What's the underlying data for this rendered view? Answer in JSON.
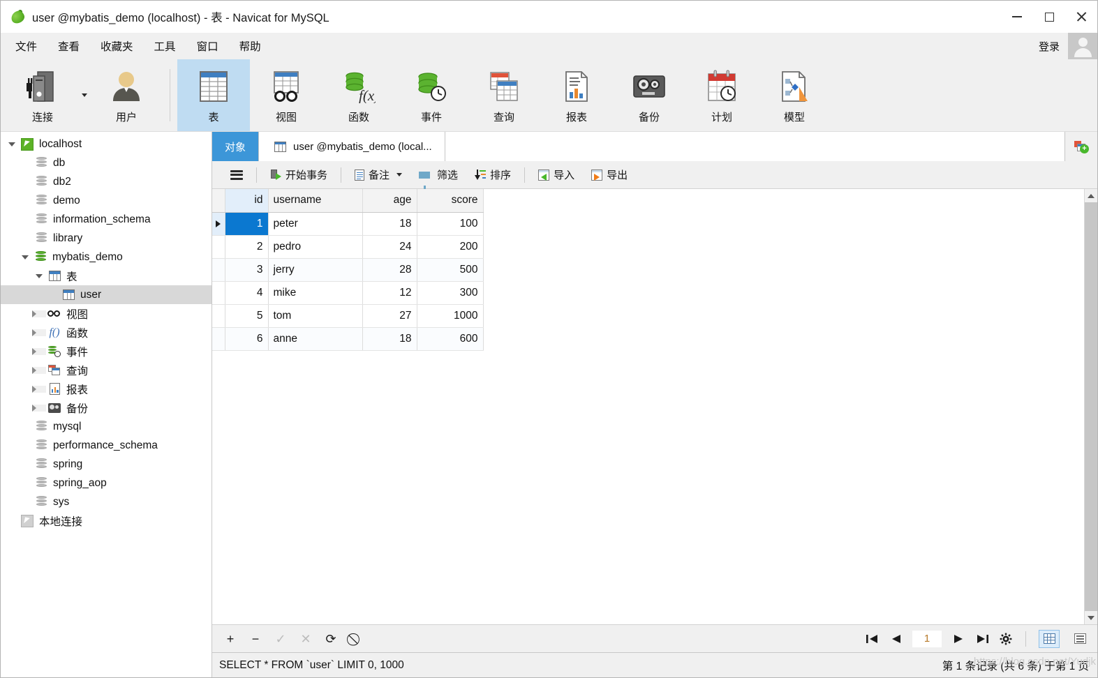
{
  "window": {
    "title": "user @mybatis_demo (localhost) - 表 - Navicat for MySQL",
    "logo": "navicat-leaf-icon",
    "minimize": "minimize-icon",
    "maximize": "maximize-icon",
    "close": "close-icon"
  },
  "menubar": {
    "items": [
      {
        "label": "文件"
      },
      {
        "label": "查看"
      },
      {
        "label": "收藏夹"
      },
      {
        "label": "工具"
      },
      {
        "label": "窗口"
      },
      {
        "label": "帮助"
      }
    ],
    "login_label": "登录"
  },
  "toolbar": {
    "items": [
      {
        "label": "连接",
        "icon": "connection-icon",
        "active": false,
        "has_dropdown": true
      },
      {
        "label": "用户",
        "icon": "user-icon",
        "active": false
      },
      {
        "label": "表",
        "icon": "table-icon",
        "active": true
      },
      {
        "label": "视图",
        "icon": "view-icon",
        "active": false
      },
      {
        "label": "函数",
        "icon": "function-icon",
        "active": false
      },
      {
        "label": "事件",
        "icon": "event-icon",
        "active": false
      },
      {
        "label": "查询",
        "icon": "query-icon",
        "active": false
      },
      {
        "label": "报表",
        "icon": "report-icon",
        "active": false
      },
      {
        "label": "备份",
        "icon": "backup-icon",
        "active": false
      },
      {
        "label": "计划",
        "icon": "schedule-icon",
        "active": false
      },
      {
        "label": "模型",
        "icon": "model-icon",
        "active": false
      }
    ]
  },
  "sidebar": {
    "nodes": [
      {
        "label": "localhost",
        "icon": "connection-green-icon",
        "indent": 0,
        "expander": "down",
        "selected": false
      },
      {
        "label": "db",
        "icon": "database-gray-icon",
        "indent": 1,
        "expander": "none",
        "selected": false
      },
      {
        "label": "db2",
        "icon": "database-gray-icon",
        "indent": 1,
        "expander": "none",
        "selected": false
      },
      {
        "label": "demo",
        "icon": "database-gray-icon",
        "indent": 1,
        "expander": "none",
        "selected": false
      },
      {
        "label": "information_schema",
        "icon": "database-gray-icon",
        "indent": 1,
        "expander": "none",
        "selected": false
      },
      {
        "label": "library",
        "icon": "database-gray-icon",
        "indent": 1,
        "expander": "none",
        "selected": false
      },
      {
        "label": "mybatis_demo",
        "icon": "database-green-icon",
        "indent": 1,
        "expander": "down",
        "selected": false
      },
      {
        "label": "表",
        "icon": "table-icon",
        "indent": 2,
        "expander": "down",
        "selected": false
      },
      {
        "label": "user",
        "icon": "table-icon",
        "indent": 3,
        "expander": "none",
        "selected": true
      },
      {
        "label": "视图",
        "icon": "view-icon",
        "indent": 2,
        "expander": "right",
        "selected": false
      },
      {
        "label": "函数",
        "icon": "function-icon",
        "indent": 2,
        "expander": "right",
        "selected": false
      },
      {
        "label": "事件",
        "icon": "event-icon",
        "indent": 2,
        "expander": "right",
        "selected": false
      },
      {
        "label": "查询",
        "icon": "query-icon",
        "indent": 2,
        "expander": "right",
        "selected": false
      },
      {
        "label": "报表",
        "icon": "report-icon",
        "indent": 2,
        "expander": "right",
        "selected": false
      },
      {
        "label": "备份",
        "icon": "backup-icon",
        "indent": 2,
        "expander": "right",
        "selected": false
      },
      {
        "label": "mysql",
        "icon": "database-gray-icon",
        "indent": 1,
        "expander": "none",
        "selected": false
      },
      {
        "label": "performance_schema",
        "icon": "database-gray-icon",
        "indent": 1,
        "expander": "none",
        "selected": false
      },
      {
        "label": "spring",
        "icon": "database-gray-icon",
        "indent": 1,
        "expander": "none",
        "selected": false
      },
      {
        "label": "spring_aop",
        "icon": "database-gray-icon",
        "indent": 1,
        "expander": "none",
        "selected": false
      },
      {
        "label": "sys",
        "icon": "database-gray-icon",
        "indent": 1,
        "expander": "none",
        "selected": false
      },
      {
        "label": "本地连接",
        "icon": "connection-gray-icon",
        "indent": 0,
        "expander": "none",
        "selected": false
      }
    ]
  },
  "tabs": {
    "items": [
      {
        "label": "对象",
        "active": true,
        "icon": "none"
      },
      {
        "label": "user @mybatis_demo (local...",
        "active": false,
        "icon": "table-icon"
      }
    ],
    "add_button": "new-query-icon"
  },
  "actionbar": {
    "menu_icon": "hamburger-icon",
    "items": [
      {
        "label": "开始事务",
        "icon": "transaction-icon",
        "dropdown": false
      },
      {
        "label": "备注",
        "icon": "note-icon",
        "dropdown": true
      },
      {
        "label": "筛选",
        "icon": "filter-icon",
        "dropdown": false
      },
      {
        "label": "排序",
        "icon": "sort-icon",
        "dropdown": false
      },
      {
        "label": "导入",
        "icon": "import-icon",
        "dropdown": false
      },
      {
        "label": "导出",
        "icon": "export-icon",
        "dropdown": false
      }
    ]
  },
  "grid": {
    "columns": [
      "id",
      "username",
      "age",
      "score"
    ],
    "active_column": "id",
    "rows": [
      {
        "id": "1",
        "username": "peter",
        "age": "18",
        "score": "100"
      },
      {
        "id": "2",
        "username": "pedro",
        "age": "24",
        "score": "200"
      },
      {
        "id": "3",
        "username": "jerry",
        "age": "28",
        "score": "500"
      },
      {
        "id": "4",
        "username": "mike",
        "age": "12",
        "score": "300"
      },
      {
        "id": "5",
        "username": "tom",
        "age": "27",
        "score": "1000"
      },
      {
        "id": "6",
        "username": "anne",
        "age": "18",
        "score": "600"
      }
    ],
    "selected_row": 0,
    "selected_cell_column": "id"
  },
  "navbar": {
    "record_actions": [
      {
        "icon": "plus-icon",
        "label": "+",
        "enabled": true
      },
      {
        "icon": "minus-icon",
        "label": "−",
        "enabled": true
      },
      {
        "icon": "check-icon",
        "label": "✓",
        "enabled": false
      },
      {
        "icon": "cancel-x-icon",
        "label": "✕",
        "enabled": false
      },
      {
        "icon": "refresh-icon",
        "label": "⟳",
        "enabled": true
      },
      {
        "icon": "stop-icon",
        "label": "⃠",
        "enabled": true
      }
    ],
    "pager": {
      "first": "first-page-icon",
      "prev": "prev-page-icon",
      "page_value": "1",
      "next": "next-page-icon",
      "last": "last-page-icon",
      "settings": "gear-icon"
    },
    "view_modes": [
      {
        "icon": "grid-view-icon",
        "active": true
      },
      {
        "icon": "form-view-icon",
        "active": false
      }
    ]
  },
  "statusbar": {
    "sql": "SELECT * FROM `user` LIMIT 0, 1000",
    "record_info": "第 1 条记录 (共 6 条) 于第 1 页",
    "watermark": "https://blog.csdn.net/Yudjk"
  },
  "colors": {
    "accent_blue": "#3c96d8",
    "selection_blue": "#0b78d0",
    "toolbar_active": "#bfdcf2",
    "chrome": "#f0f0f0"
  }
}
